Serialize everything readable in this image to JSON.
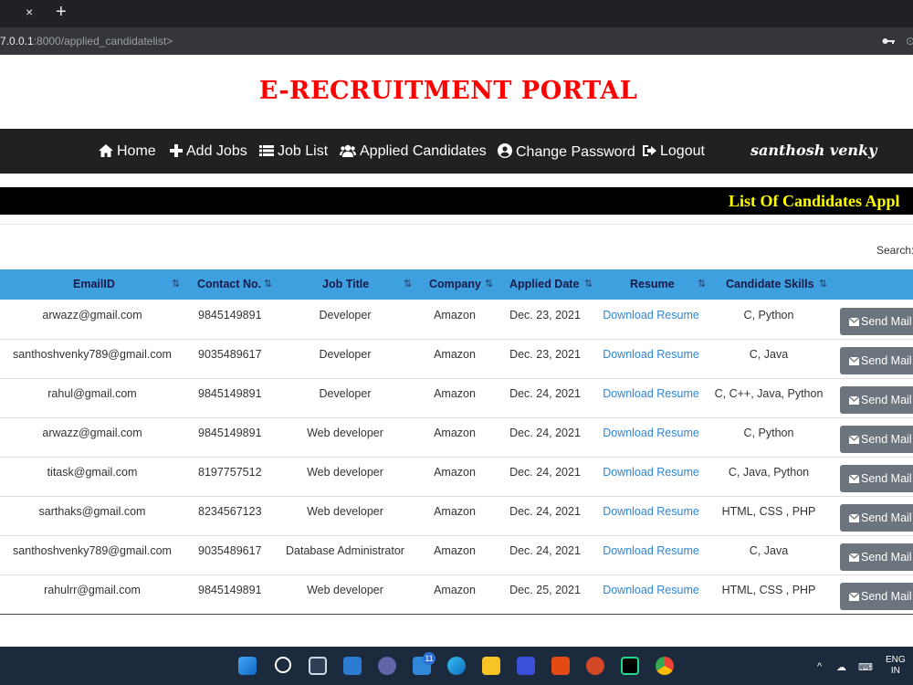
{
  "browser": {
    "tab_close": "×",
    "tab_new": "+",
    "url_host": "7.0.0.1",
    "url_rest": ":8000/applied_candidatelist>",
    "url_extra": "⊙"
  },
  "site": {
    "title": "E-RECRUITMENT PORTAL"
  },
  "nav": {
    "items": [
      {
        "label": "Home",
        "icon": "home-icon"
      },
      {
        "label": "Add Jobs",
        "icon": "plus-icon"
      },
      {
        "label": "Job List",
        "icon": "list-icon"
      },
      {
        "label": "Applied Candidates",
        "icon": "users-icon"
      },
      {
        "label": "Change Password",
        "icon": "user-circle-icon"
      },
      {
        "label": "Logout",
        "icon": "logout-icon"
      }
    ],
    "user": "santhosh venky"
  },
  "marquee": {
    "text": "List Of Candidates Appl"
  },
  "search": {
    "label": "Search:"
  },
  "table": {
    "headers": [
      "EmailID",
      "Contact No.",
      "Job Title",
      "Company",
      "Applied Date",
      "Resume",
      "Candidate Skills"
    ],
    "sort_glyph": "⇅",
    "rows": [
      {
        "email": "arwazz@gmail.com",
        "contact": "9845149891",
        "job": "Developer",
        "company": "Amazon",
        "date": "Dec. 23, 2021",
        "resume": "Download Resume",
        "skills": "C, Python",
        "action": "Send Mail"
      },
      {
        "email": "santhoshvenky789@gmail.com",
        "contact": "9035489617",
        "job": "Developer",
        "company": "Amazon",
        "date": "Dec. 23, 2021",
        "resume": "Download Resume",
        "skills": "C, Java",
        "action": "Send Mail"
      },
      {
        "email": "rahul@gmail.com",
        "contact": "9845149891",
        "job": "Developer",
        "company": "Amazon",
        "date": "Dec. 24, 2021",
        "resume": "Download Resume",
        "skills": "C, C++, Java, Python",
        "action": "Send Mail"
      },
      {
        "email": "arwazz@gmail.com",
        "contact": "9845149891",
        "job": "Web developer",
        "company": "Amazon",
        "date": "Dec. 24, 2021",
        "resume": "Download Resume",
        "skills": "C, Python",
        "action": "Send Mail"
      },
      {
        "email": "titask@gmail.com",
        "contact": "8197757512",
        "job": "Web developer",
        "company": "Amazon",
        "date": "Dec. 24, 2021",
        "resume": "Download Resume",
        "skills": "C, Java, Python",
        "action": "Send Mail"
      },
      {
        "email": "sarthaks@gmail.com",
        "contact": "8234567123",
        "job": "Web developer",
        "company": "Amazon",
        "date": "Dec. 24, 2021",
        "resume": "Download Resume",
        "skills": "HTML, CSS , PHP",
        "action": "Send Mail"
      },
      {
        "email": "santhoshvenky789@gmail.com",
        "contact": "9035489617",
        "job": "Database Administrator",
        "company": "Amazon",
        "date": "Dec. 24, 2021",
        "resume": "Download Resume",
        "skills": "C, Java",
        "action": "Send Mail"
      },
      {
        "email": "rahulrr@gmail.com",
        "contact": "9845149891",
        "job": "Web developer",
        "company": "Amazon",
        "date": "Dec. 25, 2021",
        "resume": "Download Resume",
        "skills": "HTML, CSS , PHP",
        "action": "Send Mail"
      }
    ]
  },
  "taskbar": {
    "badge": "11",
    "lang_line1": "ENG",
    "lang_line2": "IN"
  },
  "colors": {
    "title": "#ff0000",
    "navbar": "#212121",
    "table_header": "#3ea0de",
    "link": "#2f86d6",
    "button": "#6c757d",
    "marquee_text": "#ffff00"
  }
}
